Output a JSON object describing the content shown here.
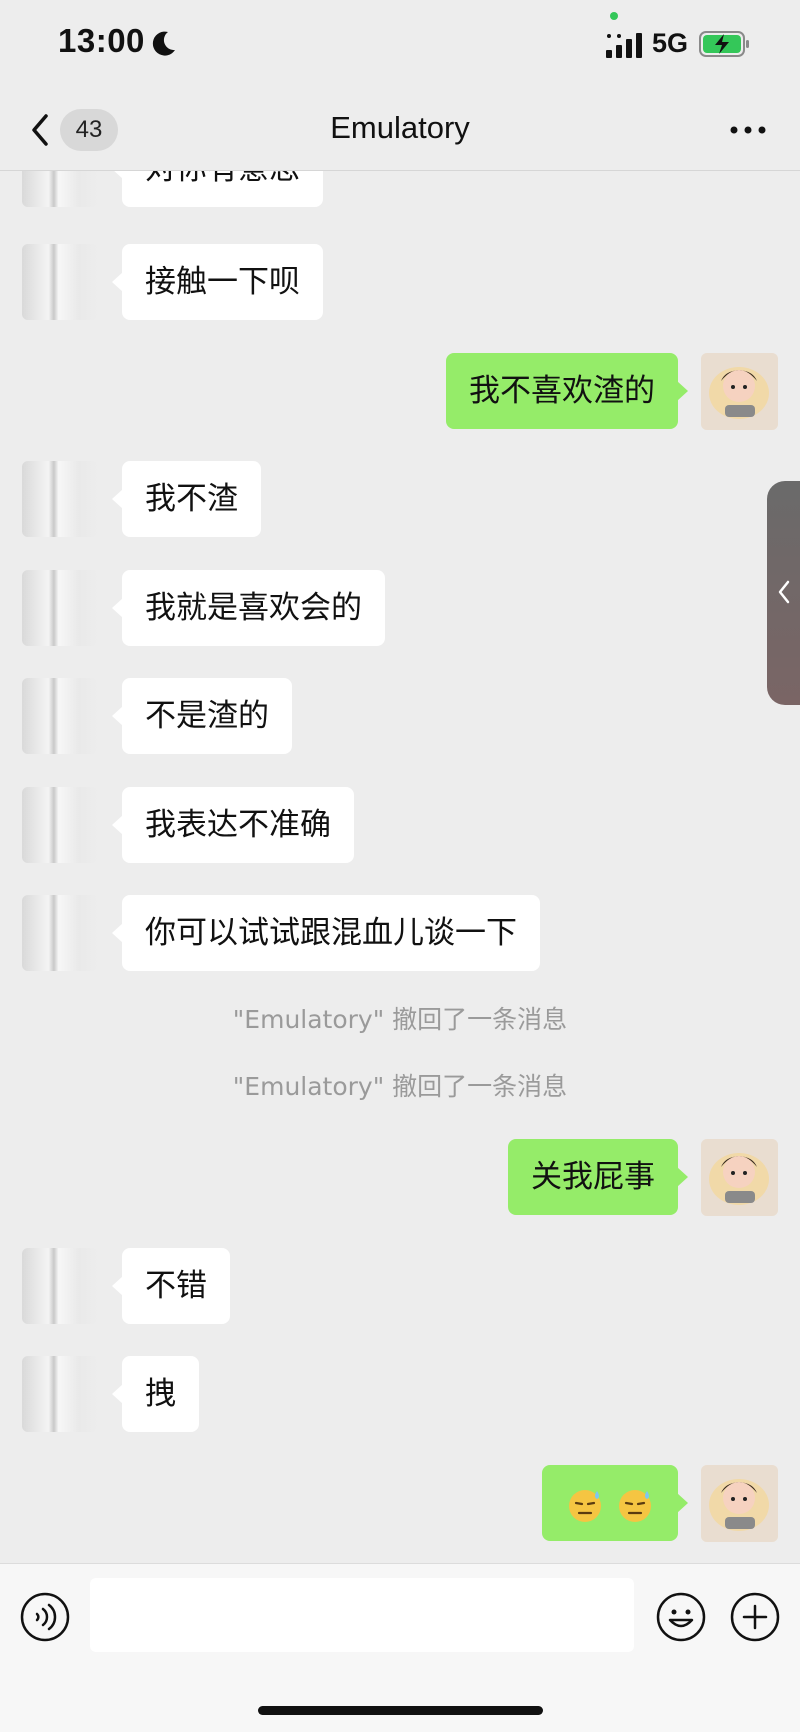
{
  "status_bar": {
    "time": "13:00",
    "network": "5G",
    "icons": [
      "moon-icon",
      "signal-icon",
      "battery-charging-icon"
    ]
  },
  "nav": {
    "back_icon": "chevron-left-icon",
    "unread_count": "43",
    "title": "Emulatory",
    "more_icon": "more-dots-icon"
  },
  "messages": [
    {
      "side": "left",
      "text": "对你有意思"
    },
    {
      "side": "left",
      "text": "接触一下呗"
    },
    {
      "side": "right",
      "text": "我不喜欢渣的"
    },
    {
      "side": "left",
      "text": "我不渣"
    },
    {
      "side": "left",
      "text": "我就是喜欢会的"
    },
    {
      "side": "left",
      "text": "不是渣的"
    },
    {
      "side": "left",
      "text": "我表达不准确"
    },
    {
      "side": "left",
      "text": "你可以试试跟混血儿谈一下"
    },
    {
      "side": "system",
      "text": "\"Emulatory\" 撤回了一条消息"
    },
    {
      "side": "system",
      "text": "\"Emulatory\" 撤回了一条消息"
    },
    {
      "side": "right",
      "text": "关我屁事"
    },
    {
      "side": "left",
      "text": "不错"
    },
    {
      "side": "left",
      "text": "拽"
    },
    {
      "side": "right",
      "text": "",
      "emoji": [
        "downcast-sweat-face",
        "downcast-sweat-face"
      ]
    }
  ],
  "side_tab": {
    "icon": "chevron-left-icon"
  },
  "input_bar": {
    "voice_icon": "voice-icon",
    "input_value": "",
    "emoji_icon": "smile-icon",
    "plus_icon": "plus-icon"
  },
  "colors": {
    "background": "#ededed",
    "my_bubble": "#95ec69",
    "their_bubble": "#ffffff",
    "system_text": "#9a9a9a"
  }
}
